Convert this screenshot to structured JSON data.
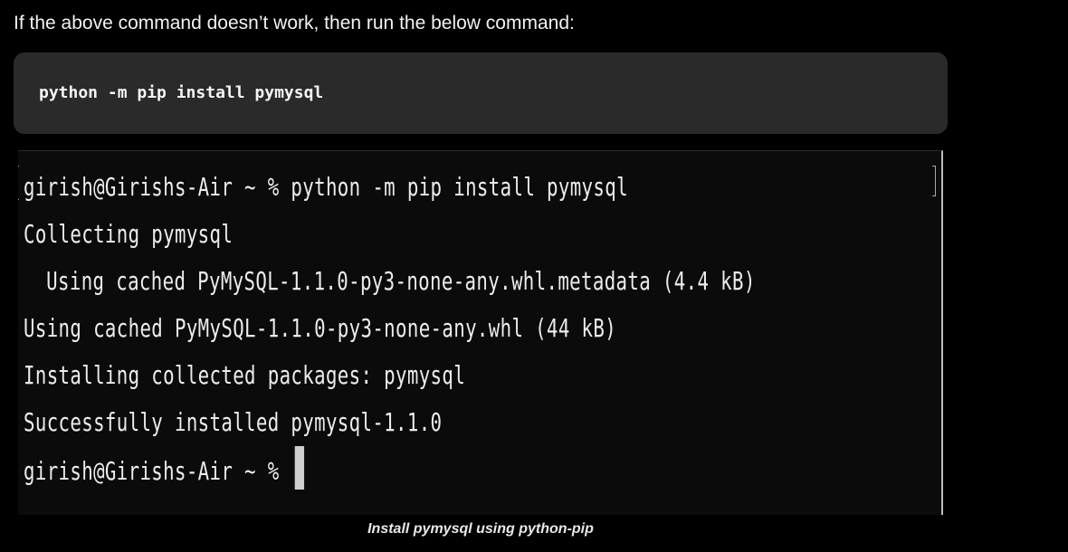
{
  "intro": {
    "text": "If the above command doesn’t work, then run the below command:"
  },
  "code_block": {
    "command": "python -m pip install pymysql"
  },
  "terminal": {
    "lines": [
      "girish@Girishs-Air ~ % python -m pip install pymysql",
      "Collecting pymysql",
      "Using cached PyMySQL-1.1.0-py3-none-any.whl.metadata (4.4 kB)",
      "Using cached PyMySQL-1.1.0-py3-none-any.whl (44 kB)",
      "Installing collected packages: pymysql",
      "Successfully installed pymysql-1.1.0",
      "girish@Girishs-Air ~ % "
    ]
  },
  "caption": {
    "text": "Install pymysql using python-pip"
  },
  "colors": {
    "page_background": "#000000",
    "code_block_background": "#2a2a2a",
    "terminal_background": "#0b0b0b",
    "terminal_text": "#ececec"
  }
}
